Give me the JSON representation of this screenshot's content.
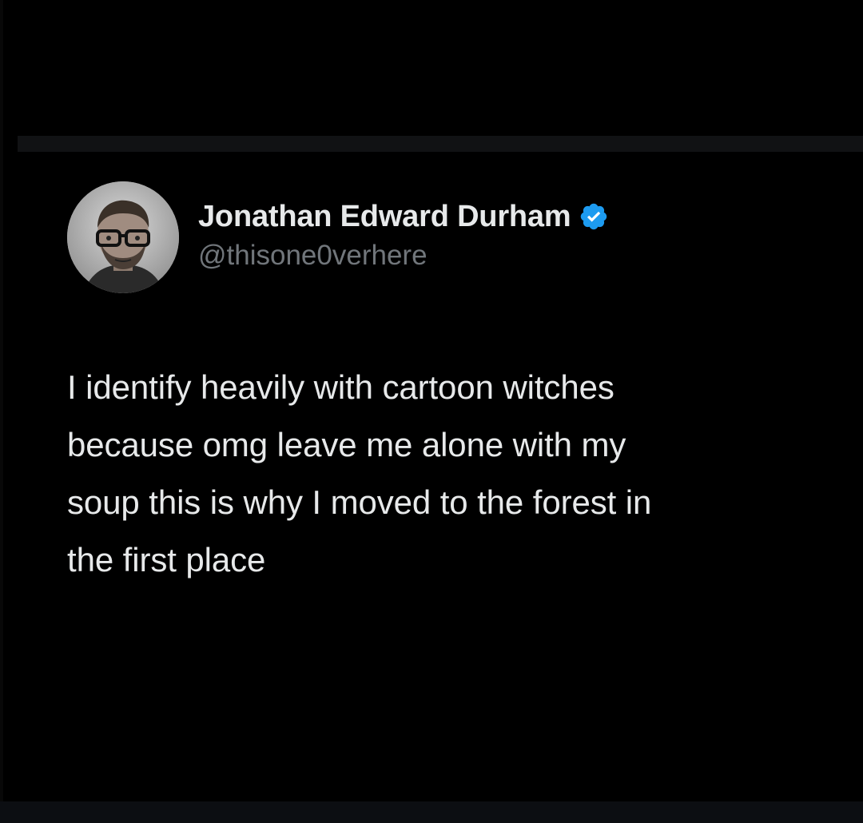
{
  "author": {
    "display_name": "Jonathan Edward Durham",
    "handle": "@thisone0verhere",
    "verified": true,
    "verified_color": "#1d9bf0",
    "avatar_icon": "profile-photo"
  },
  "tweet": {
    "lines": [
      "I identify heavily with cartoon witches",
      "because omg leave me alone with my",
      "soup this is why I moved to the forest in",
      "the first place"
    ]
  },
  "colors": {
    "background": "#000000",
    "text": "#e7e9ea",
    "secondary_text": "#71767b"
  }
}
